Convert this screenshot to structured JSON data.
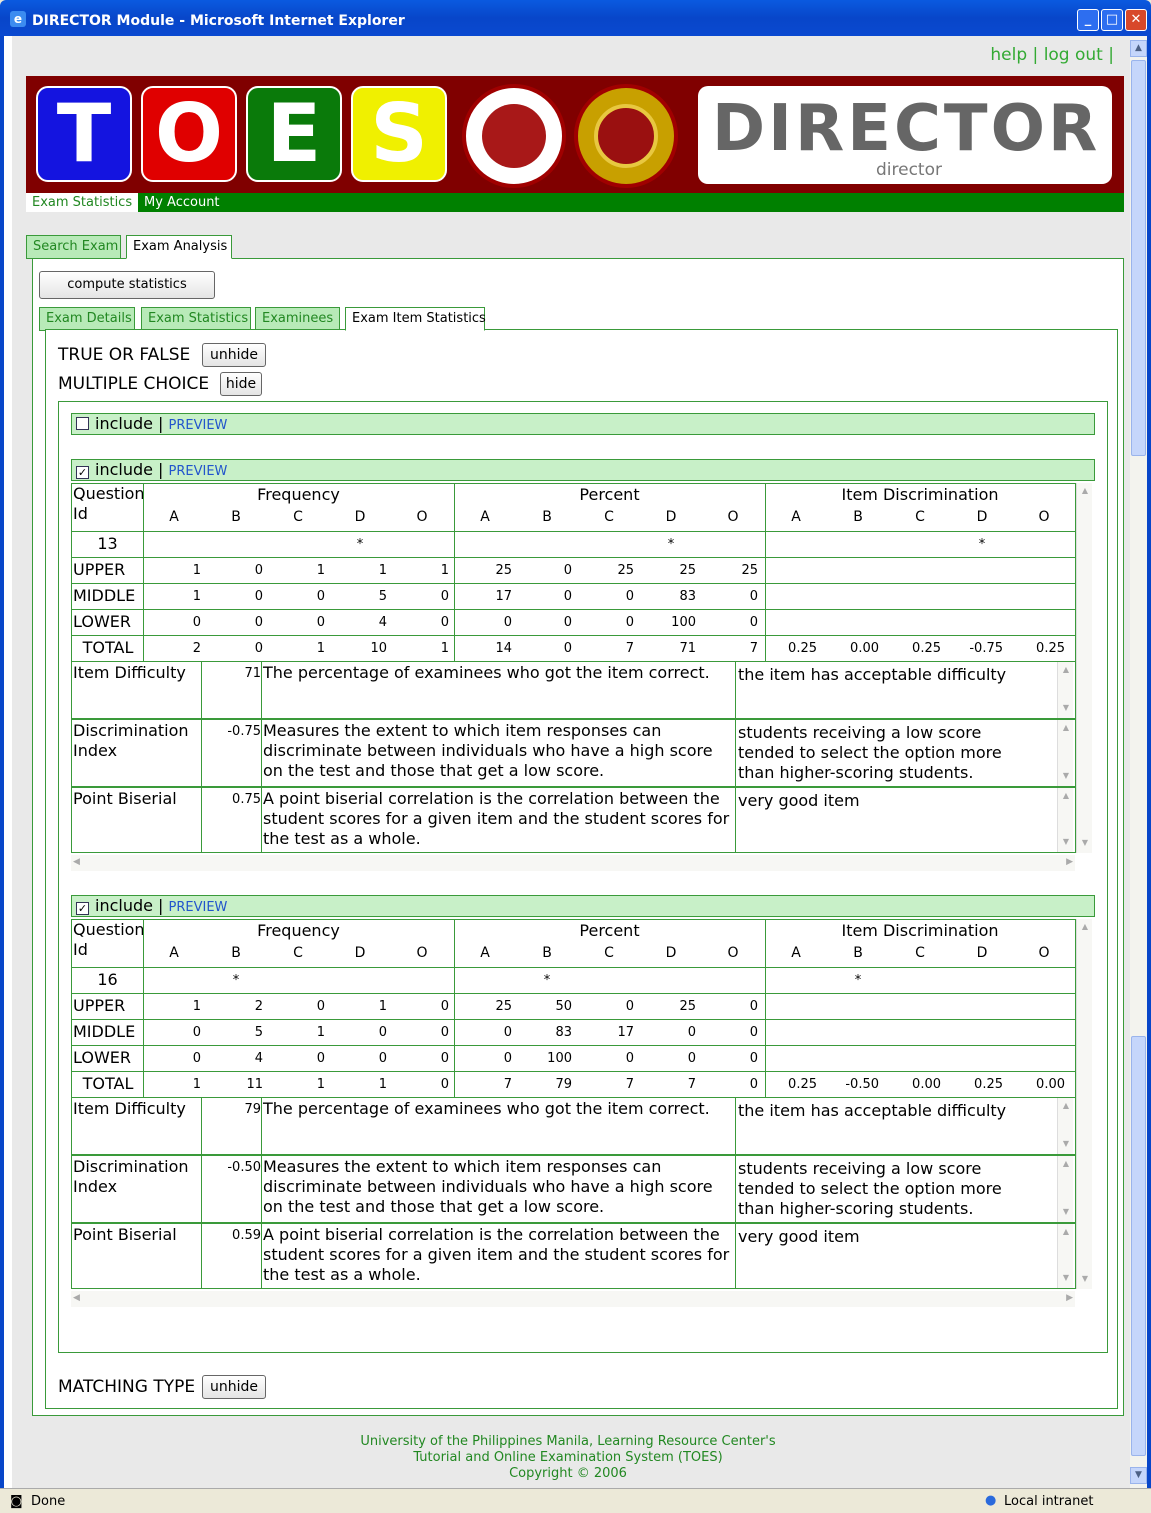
{
  "window": {
    "title": "DIRECTOR Module - Microsoft Internet Explorer"
  },
  "toplinks": {
    "help": "help",
    "logout": "log out"
  },
  "banner": {
    "letters": [
      "T",
      "O",
      "E",
      "S"
    ],
    "director_big": "DIRECTOR",
    "director_small": "director",
    "colors": {
      "T": "#1414e0",
      "O": "#e00000",
      "E": "#0a7a0a",
      "S": "#f0f000"
    }
  },
  "menu": {
    "items": [
      "Exam Statistics",
      "My Account"
    ]
  },
  "outer_tabs": [
    "Search Exam",
    "Exam Analysis"
  ],
  "compute_button": "compute statistics",
  "inner_tabs": [
    "Exam Details",
    "Exam Statistics",
    "Examinees",
    "Exam Item Statistics"
  ],
  "sections": {
    "tf": {
      "label": "TRUE OR FALSE",
      "button": "unhide"
    },
    "mc": {
      "label": "MULTIPLE CHOICE",
      "button": "hide"
    },
    "mt": {
      "label": "MATCHING TYPE",
      "button": "unhide"
    }
  },
  "include_label": "include",
  "preview_label": "PREVIEW",
  "headers": {
    "qid": "Question Id",
    "frequency": "Frequency",
    "percent": "Percent",
    "discrimination": "Item Discrimination",
    "options": [
      "A",
      "B",
      "C",
      "D",
      "O"
    ]
  },
  "row_labels": [
    "UPPER",
    "MIDDLE",
    "LOWER",
    "TOTAL"
  ],
  "metric_labels": {
    "difficulty": "Item Difficulty",
    "discrimination": "Discrimination Index",
    "biserial": "Point Biserial"
  },
  "metric_desc": {
    "difficulty": "The percentage of examinees who got the item correct.",
    "discrimination": "Measures the extent to which item responses can discriminate between individuals who have a high score on the test and those that get a low score.",
    "biserial": "A point biserial correlation is the correlation between the student scores for a given item and the student scores for the test as a whole."
  },
  "items": [
    {
      "qid": "13",
      "key_index": 3,
      "star": "*",
      "freq": [
        [
          "1",
          "0",
          "1",
          "1",
          "1"
        ],
        [
          "1",
          "0",
          "0",
          "5",
          "0"
        ],
        [
          "0",
          "0",
          "0",
          "4",
          "0"
        ],
        [
          "2",
          "0",
          "1",
          "10",
          "1"
        ]
      ],
      "pct": [
        [
          "25",
          "0",
          "25",
          "25",
          "25"
        ],
        [
          "17",
          "0",
          "0",
          "83",
          "0"
        ],
        [
          "0",
          "0",
          "0",
          "100",
          "0"
        ],
        [
          "14",
          "0",
          "7",
          "71",
          "7"
        ]
      ],
      "disc": [
        "0.25",
        "0.00",
        "0.25",
        "-0.75",
        "0.25"
      ],
      "difficulty": "71",
      "discrimination": "-0.75",
      "biserial": "0.75",
      "difficulty_note": "the item has acceptable difficulty",
      "discrimination_note": "students receiving a low score tended to select the option more than higher-scoring students.",
      "biserial_note": "very good item"
    },
    {
      "qid": "16",
      "key_index": 1,
      "star": "*",
      "freq": [
        [
          "1",
          "2",
          "0",
          "1",
          "0"
        ],
        [
          "0",
          "5",
          "1",
          "0",
          "0"
        ],
        [
          "0",
          "4",
          "0",
          "0",
          "0"
        ],
        [
          "1",
          "11",
          "1",
          "1",
          "0"
        ]
      ],
      "pct": [
        [
          "25",
          "50",
          "0",
          "25",
          "0"
        ],
        [
          "0",
          "83",
          "17",
          "0",
          "0"
        ],
        [
          "0",
          "100",
          "0",
          "0",
          "0"
        ],
        [
          "7",
          "79",
          "7",
          "7",
          "0"
        ]
      ],
      "disc": [
        "0.25",
        "-0.50",
        "0.00",
        "0.25",
        "0.00"
      ],
      "difficulty": "79",
      "discrimination": "-0.50",
      "biserial": "0.59",
      "difficulty_note": "the item has acceptable difficulty",
      "discrimination_note": "students receiving a low score tended to select the option more than higher-scoring students.",
      "biserial_note": "very good item"
    }
  ],
  "footer": {
    "line1": "University of the Philippines Manila, Learning Resource Center's",
    "line2": "Tutorial and Online Examination System (TOES)",
    "line3": "Copyright © 2006"
  },
  "status": {
    "left": "Done",
    "right": "Local intranet"
  }
}
